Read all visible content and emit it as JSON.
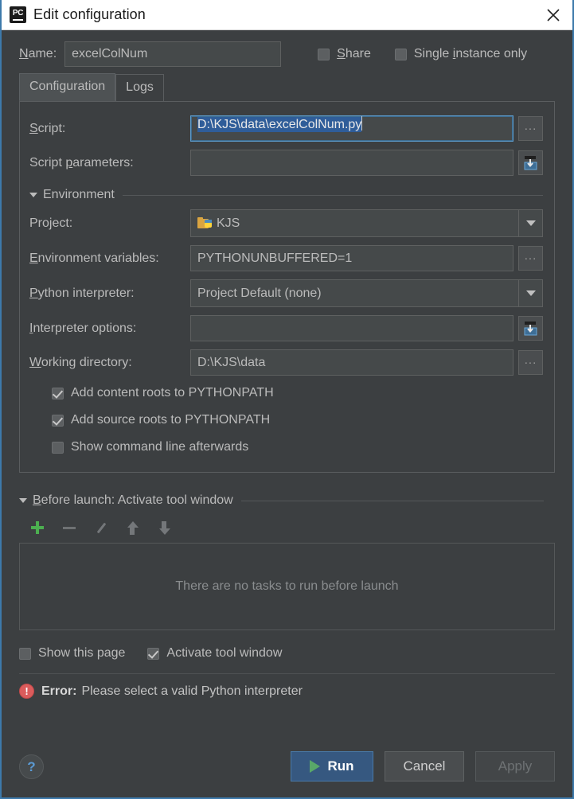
{
  "window": {
    "title": "Edit configuration",
    "app_icon": "pycharm-logo",
    "close_icon": "close-icon"
  },
  "name_row": {
    "label": "Name:",
    "value": "excelColNum",
    "placeholder": "",
    "share": {
      "label": "Share",
      "checked": false
    },
    "single_instance": {
      "label": "Single instance only",
      "checked": false
    }
  },
  "tabs": [
    {
      "id": "configuration",
      "label": "Configuration",
      "active": true
    },
    {
      "id": "logs",
      "label": "Logs",
      "active": false
    }
  ],
  "configuration": {
    "script": {
      "label": "Script:",
      "value": "D:\\KJS\\data\\excelColNum.py",
      "selected": true,
      "focused": true,
      "browse_label": "..."
    },
    "script_parameters": {
      "label": "Script parameters:",
      "value": "",
      "expand_icon": "insert-expression-icon"
    },
    "environment_group": {
      "title": "Environment",
      "expanded": true,
      "collapse_icon": "triangle-down-icon"
    },
    "project": {
      "label": "Project:",
      "value": "KJS",
      "icon": "project-folder-python-icon",
      "dropdown_icon": "chevron-down-icon"
    },
    "environment_variables": {
      "label": "Environment variables:",
      "value": "PYTHONUNBUFFERED=1",
      "browse_label": "..."
    },
    "python_interpreter": {
      "label": "Python interpreter:",
      "value": "Project Default (none)",
      "dropdown_icon": "chevron-down-icon"
    },
    "interpreter_options": {
      "label": "Interpreter options:",
      "value": "",
      "expand_icon": "insert-expression-icon"
    },
    "working_directory": {
      "label": "Working directory:",
      "value": "D:\\KJS\\data",
      "browse_label": "..."
    },
    "checkboxes": [
      {
        "id": "add-content-roots",
        "label": "Add content roots to PYTHONPATH",
        "checked": true
      },
      {
        "id": "add-source-roots",
        "label": "Add source roots to PYTHONPATH",
        "checked": true
      },
      {
        "id": "show-command-line",
        "label": "Show command line afterwards",
        "checked": false
      }
    ]
  },
  "before_launch": {
    "title": "Before launch: Activate tool window",
    "expanded": true,
    "collapse_icon": "triangle-down-icon",
    "toolbar": [
      {
        "id": "add",
        "icon": "plus-icon",
        "enabled": true
      },
      {
        "id": "remove",
        "icon": "minus-icon",
        "enabled": false
      },
      {
        "id": "edit",
        "icon": "pencil-icon",
        "enabled": false
      },
      {
        "id": "move-up",
        "icon": "arrow-up-icon",
        "enabled": false
      },
      {
        "id": "move-down",
        "icon": "arrow-down-icon",
        "enabled": false
      }
    ],
    "empty_message": "There are no tasks to run before launch",
    "options": [
      {
        "id": "show-this-page",
        "label": "Show this page",
        "checked": false
      },
      {
        "id": "activate-tool-window",
        "label": "Activate tool window",
        "checked": true
      }
    ]
  },
  "error": {
    "icon": "error-icon",
    "prefix": "Error:",
    "message": "Please select a valid Python interpreter"
  },
  "footer": {
    "help_label": "?",
    "run_label": "Run",
    "run_icon": "play-icon",
    "cancel_label": "Cancel",
    "apply_label": "Apply",
    "apply_enabled": false
  },
  "colors": {
    "dialog_bg": "#3c3f41",
    "field_bg": "#45494a",
    "accent_blue": "#365880",
    "selection_blue": "#2f5d99",
    "focus_border": "#5e9ccc",
    "green": "#59a869",
    "error_red": "#db5c5c",
    "text": "#bbbbbb"
  }
}
